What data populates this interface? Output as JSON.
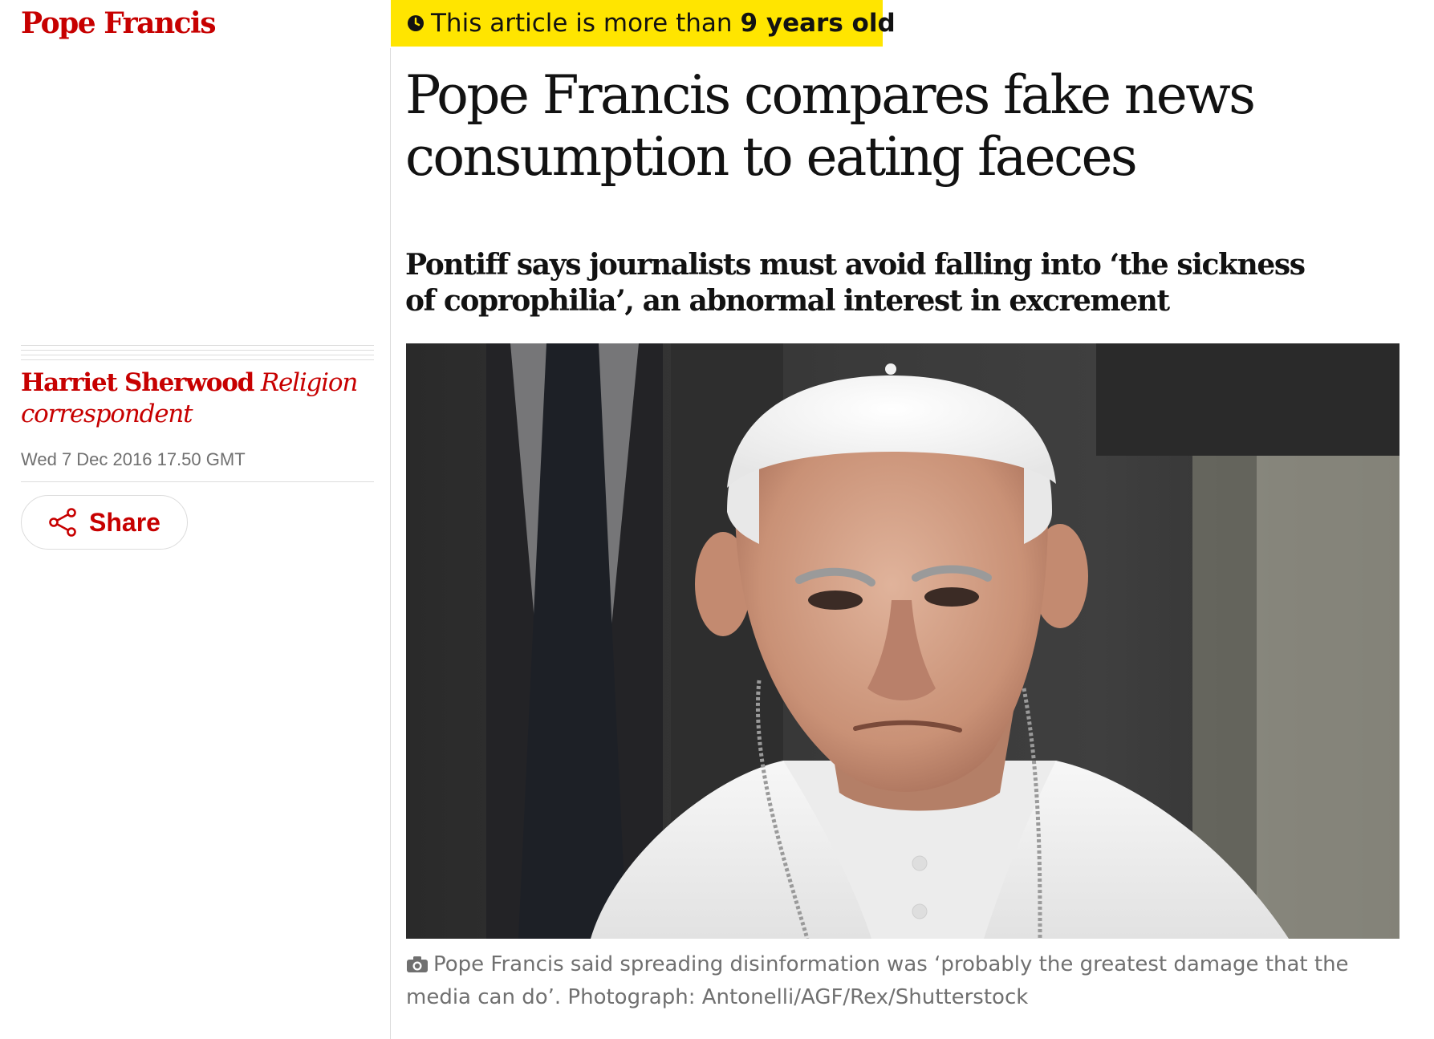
{
  "section": {
    "tag": "Pope Francis"
  },
  "banner": {
    "prefix": "This article is more than",
    "age": "9 years old"
  },
  "article": {
    "headline": "Pope Francis compares fake news consumption to eating faeces",
    "standfirst": "Pontiff says journalists must avoid falling into ‘the sickness of coprophilia’, an abnormal interest in excrement"
  },
  "byline": {
    "author": "Harriet Sherwood",
    "role": "Religion correspondent",
    "date": "Wed 7 Dec 2016 17.50 GMT"
  },
  "share": {
    "label": "Share"
  },
  "image": {
    "caption": "Pope Francis said spreading disinformation was ‘probably the greatest damage that the media can do’. Photograph: Antonelli/AGF/Rex/Shutterstock"
  },
  "icons": {
    "clock": "clock-icon",
    "share": "share-icon",
    "camera": "camera-icon"
  },
  "colors": {
    "accent": "#c70000",
    "banner": "#ffe500",
    "text": "#121212",
    "muted": "#707070"
  }
}
